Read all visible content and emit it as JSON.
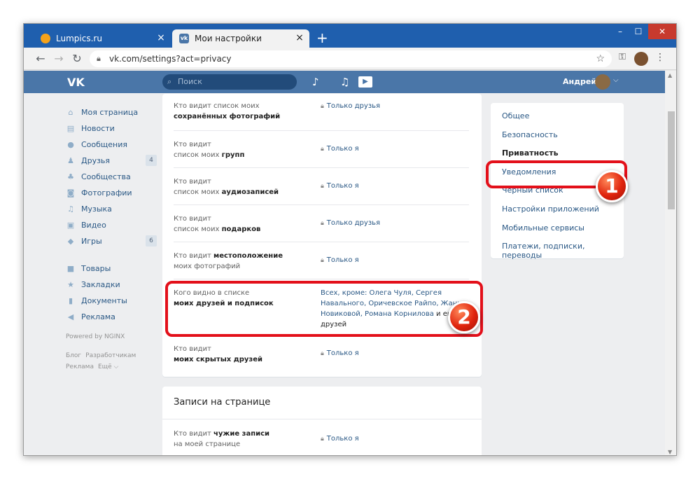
{
  "browser": {
    "tabs": [
      {
        "label": "Lumpics.ru",
        "icon": "lumpics-favicon"
      },
      {
        "label": "Мои настройки",
        "icon": "vk-favicon"
      }
    ],
    "new_tab": "+",
    "url": "vk.com/settings?act=privacy",
    "window_controls": {
      "minimize": "–",
      "maximize": "☐",
      "close": "✕"
    }
  },
  "vk": {
    "logo": "VK",
    "search_placeholder": "Поиск",
    "user_name": "Андрей",
    "left_nav": [
      {
        "label": "Моя страница",
        "icon": "home-icon",
        "glyph": "⌂"
      },
      {
        "label": "Новости",
        "icon": "news-icon",
        "glyph": "▤"
      },
      {
        "label": "Сообщения",
        "icon": "messages-icon",
        "glyph": "●"
      },
      {
        "label": "Друзья",
        "icon": "friends-icon",
        "glyph": "♟",
        "count": "4"
      },
      {
        "label": "Сообщества",
        "icon": "communities-icon",
        "glyph": "♣"
      },
      {
        "label": "Фотографии",
        "icon": "photos-icon",
        "glyph": "◙"
      },
      {
        "label": "Музыка",
        "icon": "music-icon",
        "glyph": "♫"
      },
      {
        "label": "Видео",
        "icon": "video-icon",
        "glyph": "▣"
      },
      {
        "label": "Игры",
        "icon": "games-icon",
        "glyph": "◆",
        "count": "6"
      }
    ],
    "left_nav2": [
      {
        "label": "Товары",
        "icon": "goods-icon",
        "glyph": "■"
      },
      {
        "label": "Закладки",
        "icon": "bookmarks-icon",
        "glyph": "★"
      },
      {
        "label": "Документы",
        "icon": "documents-icon",
        "glyph": "▮"
      },
      {
        "label": "Реклама",
        "icon": "ads-icon",
        "glyph": "◀"
      }
    ],
    "powered_by": "Powered by NGINX",
    "footer_links": [
      "Блог",
      "Разработчикам",
      "Реклама",
      "Ещё ⌵"
    ]
  },
  "privacy_rows": [
    {
      "label_pre": "Кто видит список моих",
      "label_bold": "сохранённых фотографий",
      "value": "Только друзья"
    },
    {
      "label_pre": "Кто видит",
      "label_mid": "список моих ",
      "label_bold": "групп",
      "value": "Только я"
    },
    {
      "label_pre": "Кто видит",
      "label_mid": "список моих ",
      "label_bold": "аудиозаписей",
      "value": "Только я"
    },
    {
      "label_pre": "Кто видит",
      "label_mid": "список моих ",
      "label_bold": "подарков",
      "value": "Только друзья"
    },
    {
      "label_pre": "Кто видит ",
      "label_bold": "местоположение",
      "label_post": "моих фотографий",
      "value": "Только я"
    },
    {
      "label_pre": "Кого видно в списке",
      "label_bold": "моих друзей и подписок",
      "value_link": "Всех, кроме: Олега Чуля, Сергея Навального, Оричевское Райпо, Жанны Новиковой, Романа Корнилова",
      "value_tail": " и ещё 22 друзей"
    },
    {
      "label_pre": "Кто видит",
      "label_bold": "моих скрытых друзей",
      "value": "Только я"
    }
  ],
  "wall_section": {
    "title": "Записи на странице",
    "row": {
      "label_pre": "Кто видит ",
      "label_bold": "чужие записи",
      "label_post": "на моей странице",
      "value": "Только я"
    }
  },
  "right_menu": [
    {
      "label": "Общее"
    },
    {
      "label": "Безопасность"
    },
    {
      "label": "Приватность",
      "active": true
    },
    {
      "label": "Уведомления"
    },
    {
      "label": "Чёрный список"
    },
    {
      "label": "Настройки приложений"
    },
    {
      "label": "Мобильные сервисы"
    },
    {
      "label": "Платежи, подписки, переводы"
    }
  ],
  "annotations": {
    "badge1": "1",
    "badge2": "2",
    "color": "#e3101a"
  }
}
